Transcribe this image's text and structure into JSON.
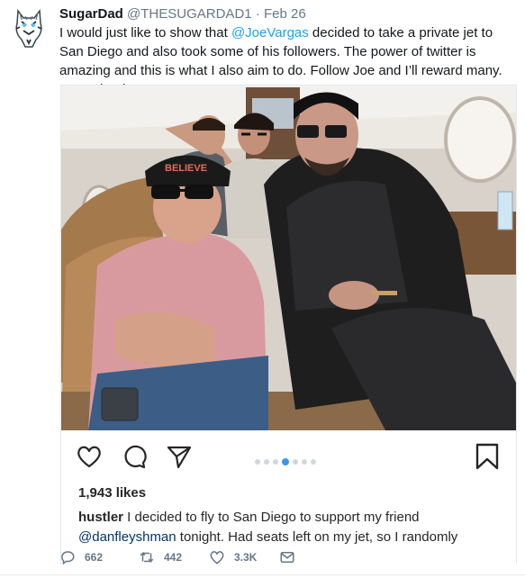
{
  "tweet": {
    "display_name": "SugarDad",
    "handle": "@THESUGARDAD1",
    "separator": "·",
    "date": "Feb 26",
    "text_before": "I would just like to show that ",
    "mention": "@JoeVargas",
    "text_after": " decided to take a private jet to San Diego and also took some of his followers. The power of twitter is amazing and this is what I also aim to do. Follow Joe and I’ll reward many. Many thanks."
  },
  "instagram": {
    "likes": "1,943 likes",
    "caption_user": "hustler",
    "caption_text_1": " I decided to fly to San Diego to support my friend ",
    "caption_mention": "@danfleyshman",
    "caption_text_2": " tonight. Had seats left on my jet, so I randomly",
    "hat_text": "BELIEVE",
    "carousel_dots": 7,
    "carousel_active": 3
  },
  "actions": {
    "replies": "662",
    "retweets": "442",
    "likes": "3.3K"
  },
  "colors": {
    "link": "#1da1f2",
    "muted": "#657786",
    "carousel_active": "#3897f0"
  },
  "icons": [
    "tiger-avatar-icon",
    "heart-outline-icon",
    "comment-icon",
    "share-plane-icon",
    "bookmark-icon",
    "reply-icon",
    "retweet-icon",
    "like-heart-icon",
    "dm-envelope-icon"
  ]
}
